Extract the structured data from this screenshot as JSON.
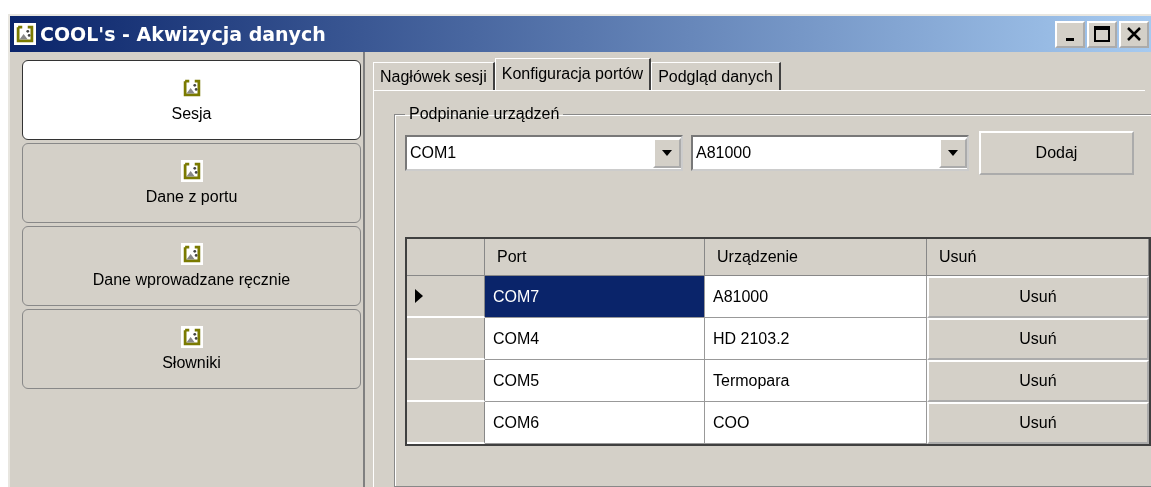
{
  "window": {
    "title": "COOL's - Akwizycja danych"
  },
  "sidebar": {
    "items": [
      {
        "label": "Sesja",
        "selected": true
      },
      {
        "label": "Dane z portu",
        "selected": false
      },
      {
        "label": "Dane wprowadzane ręcznie",
        "selected": false
      },
      {
        "label": "Słowniki",
        "selected": false
      }
    ]
  },
  "tabs": [
    {
      "label": "Nagłówek sesji",
      "selected": false
    },
    {
      "label": "Konfiguracja portów",
      "selected": true
    },
    {
      "label": "Podgląd danych",
      "selected": false
    }
  ],
  "group": {
    "title": "Podpinanie urządzeń",
    "port_combo": {
      "value": "COM1"
    },
    "device_combo": {
      "value": "A81000"
    },
    "add_button": "Dodaj"
  },
  "grid": {
    "columns": [
      "Port",
      "Urządzenie",
      "Usuń"
    ],
    "rows": [
      {
        "port": "COM7",
        "device": "A81000",
        "action": "Usuń",
        "current": true,
        "selected": true
      },
      {
        "port": "COM4",
        "device": "HD 2103.2",
        "action": "Usuń",
        "current": false,
        "selected": false
      },
      {
        "port": "COM5",
        "device": "Termopara",
        "action": "Usuń",
        "current": false,
        "selected": false
      },
      {
        "port": "COM6",
        "device": "COO",
        "action": "Usuń",
        "current": false,
        "selected": false
      }
    ]
  }
}
